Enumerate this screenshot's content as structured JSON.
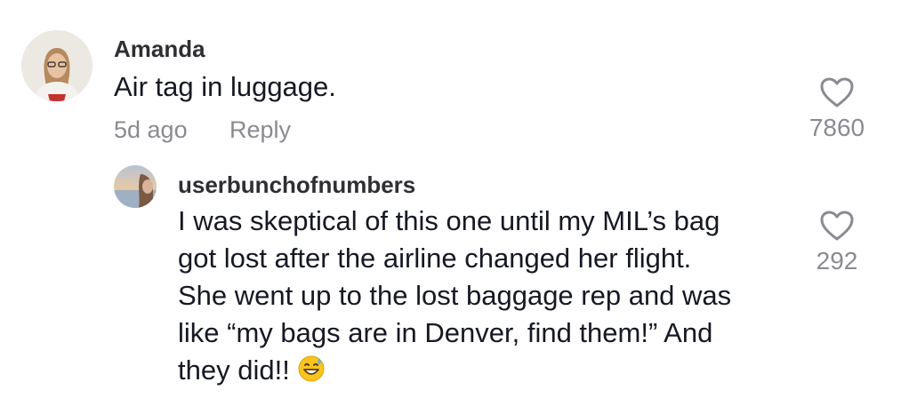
{
  "comments": [
    {
      "username": "Amanda",
      "text": "Air tag in luggage.",
      "age": "5d ago",
      "reply_label": "Reply",
      "likes": "7860"
    },
    {
      "username": "userbunchofnumbers",
      "text_lines": [
        "I was skeptical of this one until my MIL’s bag",
        "got lost after the airline changed her flight.",
        "She went up to the lost baggage rep and was",
        "like “my bags are in Denver, find them!” And",
        "they did!!"
      ],
      "emoji": "grinning-face-with-sweat",
      "likes": "292"
    }
  ],
  "colors": {
    "text": "#161823",
    "secondary": "#8a8b91",
    "username": "#2f2f33"
  }
}
